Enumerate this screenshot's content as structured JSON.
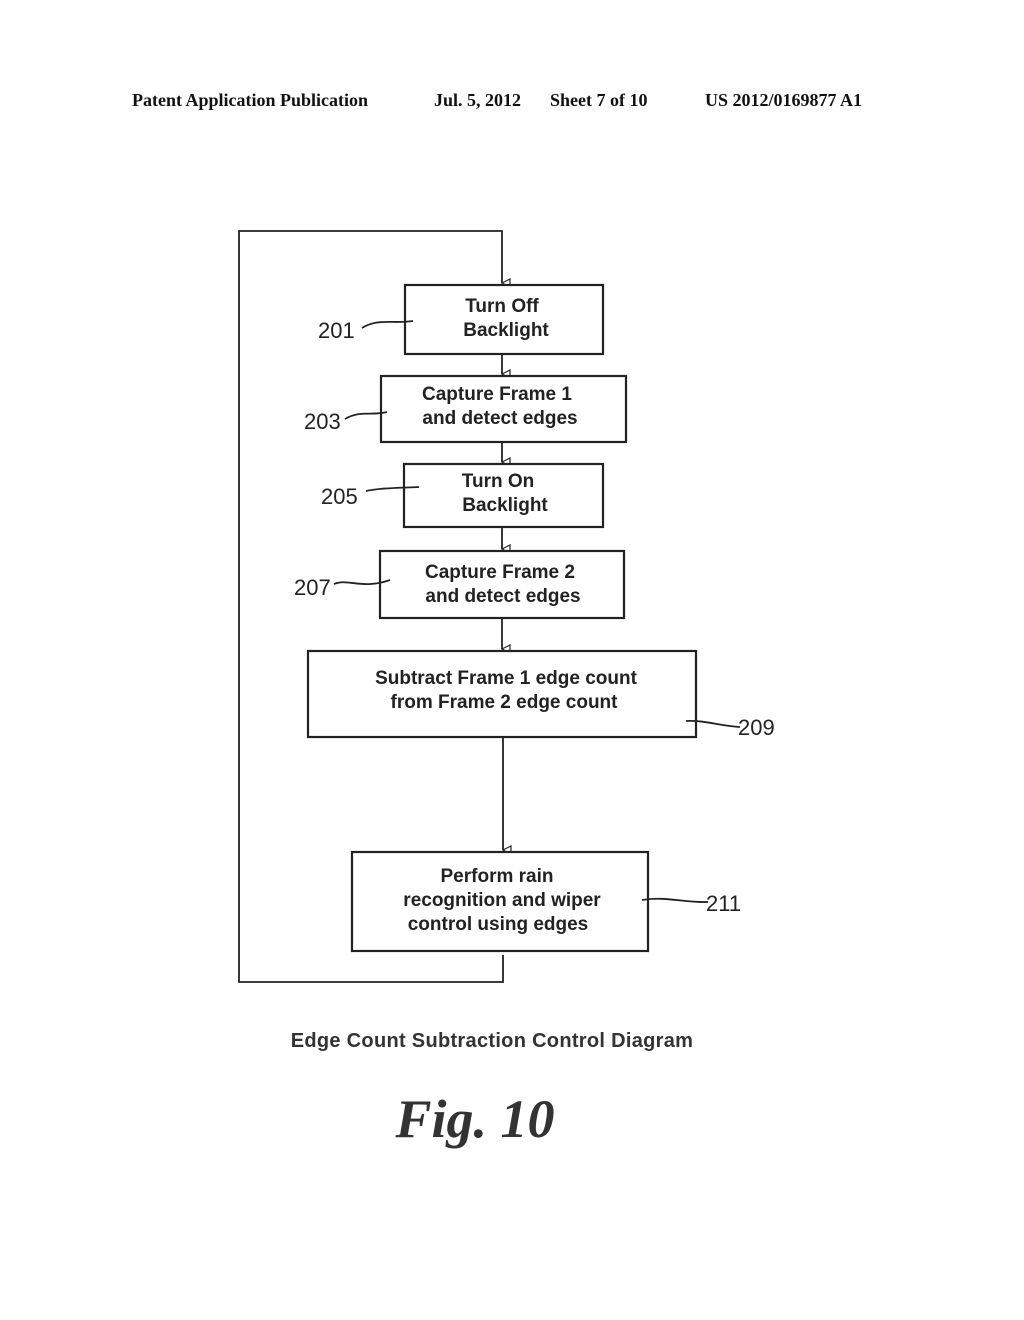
{
  "header": {
    "publication": "Patent Application Publication",
    "date": "Jul. 5, 2012",
    "sheet": "Sheet 7 of 10",
    "number": "US 2012/0169877 A1"
  },
  "flowchart": {
    "steps": [
      {
        "ref": "201",
        "lines": [
          "Turn Off",
          "Backlight"
        ]
      },
      {
        "ref": "203",
        "lines": [
          "Capture Frame 1",
          "and detect edges"
        ]
      },
      {
        "ref": "205",
        "lines": [
          "Turn On",
          "Backlight"
        ]
      },
      {
        "ref": "207",
        "lines": [
          "Capture Frame 2",
          "and detect edges"
        ]
      },
      {
        "ref": "209",
        "lines": [
          "Subtract Frame 1 edge count",
          "from Frame 2 edge count"
        ]
      },
      {
        "ref": "211",
        "lines": [
          "Perform rain",
          "recognition and wiper",
          "control using edges"
        ]
      }
    ],
    "loop": "return from step 211 to step 201"
  },
  "caption": "Edge Count Subtraction Control Diagram",
  "figure_label": "Fig. 10"
}
